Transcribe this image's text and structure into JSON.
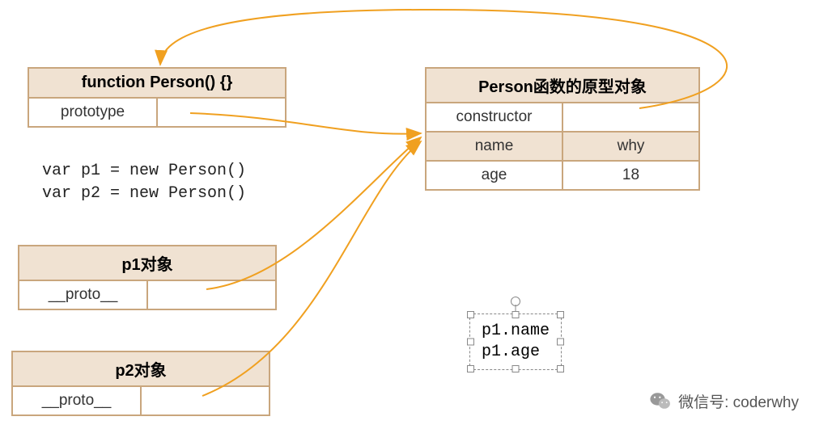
{
  "personFn": {
    "title": "function Person() {}",
    "row1_left": "prototype",
    "row1_right": ""
  },
  "proto": {
    "title": "Person函数的原型对象",
    "rows": [
      {
        "k": "constructor",
        "v": ""
      },
      {
        "k": "name",
        "v": "why"
      },
      {
        "k": "age",
        "v": "18"
      }
    ]
  },
  "code": "var p1 = new Person()\nvar p2 = new Person()",
  "p1": {
    "title": "p1对象",
    "row1_left": "__proto__",
    "row1_right": ""
  },
  "p2": {
    "title": "p2对象",
    "row1_left": "__proto__",
    "row1_right": ""
  },
  "floating": "p1.name\np1.age",
  "credit": "微信号: coderwhy",
  "colors": {
    "border": "#c9a67d",
    "fill": "#f0e2d2",
    "arrow": "#f0a020"
  }
}
